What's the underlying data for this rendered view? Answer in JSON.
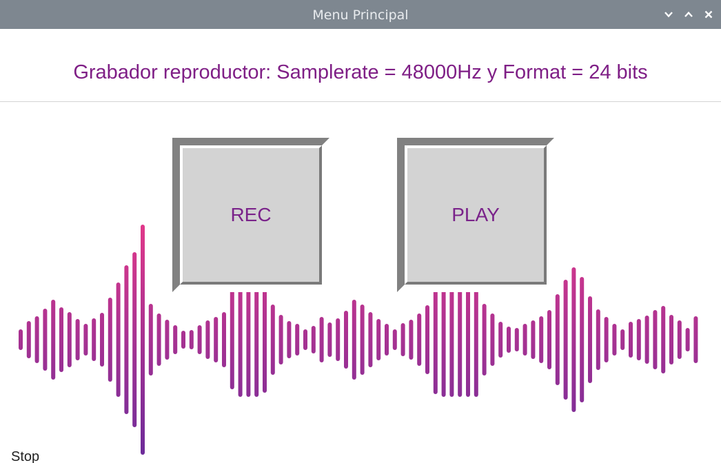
{
  "window": {
    "title": "Menu Principal",
    "controls": [
      "chevron-down-icon",
      "chevron-up-icon",
      "close-icon"
    ]
  },
  "header": {
    "text": "Grabador reproductor: Samplerate = 48000Hz y Format = 24 bits"
  },
  "buttons": {
    "rec_label": "REC",
    "play_label": "PLAY"
  },
  "background": {
    "image": "sound-wave-bars",
    "gradient_top": "#e0388a",
    "gradient_bottom": "#6a2b9a"
  },
  "bottom_fragment": {
    "text": "Stop"
  },
  "colors": {
    "accent_text": "#7f1f86",
    "titlebar": "#7e8790",
    "button_face": "#d3d3d3"
  }
}
